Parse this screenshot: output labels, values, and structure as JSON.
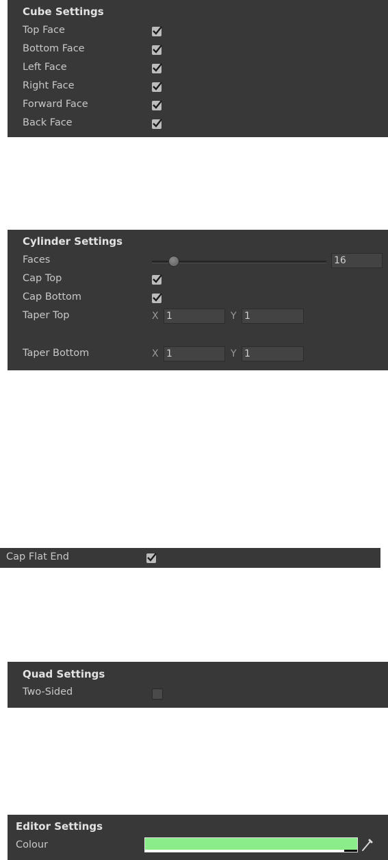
{
  "cube": {
    "title": "Cube Settings",
    "items": [
      {
        "label": "Top Face",
        "checked": true
      },
      {
        "label": "Bottom Face",
        "checked": true
      },
      {
        "label": "Left Face",
        "checked": true
      },
      {
        "label": "Right Face",
        "checked": true
      },
      {
        "label": "Forward Face",
        "checked": true
      },
      {
        "label": "Back Face",
        "checked": true
      }
    ]
  },
  "cylinder": {
    "title": "Cylinder Settings",
    "faces_label": "Faces",
    "faces_value": "16",
    "faces_slider_fraction": 0.12,
    "cap_top_label": "Cap Top",
    "cap_top_checked": true,
    "cap_bottom_label": "Cap Bottom",
    "cap_bottom_checked": true,
    "taper_top_label": "Taper Top",
    "taper_top_x_label": "X",
    "taper_top_x": "1",
    "taper_top_y_label": "Y",
    "taper_top_y": "1",
    "taper_bottom_label": "Taper Bottom",
    "taper_bottom_x_label": "X",
    "taper_bottom_x": "1",
    "taper_bottom_y_label": "Y",
    "taper_bottom_y": "1"
  },
  "cap_flat_end": {
    "label": "Cap Flat End",
    "checked": true
  },
  "quad": {
    "title": "Quad Settings",
    "two_sided_label": "Two-Sided",
    "two_sided_checked": false
  },
  "editor": {
    "title": "Editor Settings",
    "colour_label": "Colour",
    "colour_value": "#8bed89",
    "eyedropper_icon": "eyedropper-icon"
  },
  "colors": {
    "panel_bg": "#383838",
    "checkbox_bg": "#bcbcbc",
    "check_mark": "#1a1a1a"
  }
}
